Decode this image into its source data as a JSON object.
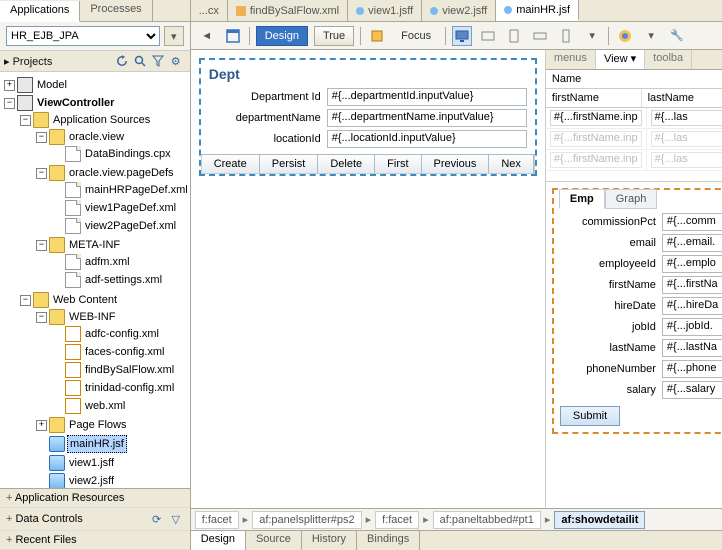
{
  "left": {
    "tabs": [
      "Applications",
      "Processes"
    ],
    "active_tab": 0,
    "dropdown": "HR_EJB_JPA",
    "section": "Projects",
    "tree": {
      "model": "Model",
      "vc": "ViewController",
      "app_src": "Application Sources",
      "ov": "oracle.view",
      "db": "DataBindings.cpx",
      "ovpd": "oracle.view.pageDefs",
      "pd1": "mainHRPageDef.xml",
      "pd2": "view1PageDef.xml",
      "pd3": "view2PageDef.xml",
      "meta": "META-INF",
      "adfm": "adfm.xml",
      "adfs": "adf-settings.xml",
      "wc": "Web Content",
      "webinf": "WEB-INF",
      "wi1": "adfc-config.xml",
      "wi2": "faces-config.xml",
      "wi3": "findBySalFlow.xml",
      "wi4": "trinidad-config.xml",
      "wi5": "web.xml",
      "pf": "Page Flows",
      "main": "mainHR.jsf",
      "v1": "view1.jsff",
      "v2": "view2.jsff"
    },
    "accordions": [
      "Application Resources",
      "Data Controls",
      "Recent Files"
    ]
  },
  "editor": {
    "tabs": [
      {
        "label": "...cx"
      },
      {
        "label": "findBySalFlow.xml"
      },
      {
        "label": "view1.jsff"
      },
      {
        "label": "view2.jsff"
      },
      {
        "label": "mainHR.jsf"
      }
    ],
    "active_tab": 4,
    "toolbar": {
      "design": "Design",
      "true": "True",
      "focus": "Focus"
    }
  },
  "dept": {
    "title": "Dept",
    "fields": [
      {
        "label": "Department Id",
        "value": "#{...departmentId.inputValue}"
      },
      {
        "label": "departmentName",
        "value": "#{...departmentName.inputValue}"
      },
      {
        "label": "locationId",
        "value": "#{...locationId.inputValue}"
      }
    ],
    "buttons": [
      "Create",
      "Persist",
      "Delete",
      "First",
      "Previous",
      "Nex"
    ]
  },
  "palette": {
    "tabs": [
      "menus",
      "View",
      "toolba"
    ],
    "active": 1,
    "table": {
      "header_full": "Name",
      "headers": [
        "firstName",
        "lastName"
      ],
      "rows": [
        [
          "#{...firstName.inp",
          "#{...las"
        ],
        [
          "#{...firstName.inp",
          "#{...las"
        ],
        [
          "#{...firstName.inp",
          "#{...las"
        ]
      ]
    }
  },
  "emp": {
    "tabs": [
      "Emp",
      "Graph"
    ],
    "active": 0,
    "fields": [
      {
        "label": "commissionPct",
        "value": "#{...comm"
      },
      {
        "label": "email",
        "value": "#{...email."
      },
      {
        "label": "employeeId",
        "value": "#{...emplo"
      },
      {
        "label": "firstName",
        "value": "#{...firstNa"
      },
      {
        "label": "hireDate",
        "value": "#{...hireDa"
      },
      {
        "label": "jobId",
        "value": "#{...jobId."
      },
      {
        "label": "lastName",
        "value": "#{...lastNa"
      },
      {
        "label": "phoneNumber",
        "value": "#{...phone"
      },
      {
        "label": "salary",
        "value": "#{...salary"
      }
    ],
    "submit": "Submit"
  },
  "breadcrumb": [
    "f:facet",
    "af:panelsplitter#ps2",
    "f:facet",
    "af:paneltabbed#pt1",
    "af:showdetailit"
  ],
  "bottom_tabs": [
    "Design",
    "Source",
    "History",
    "Bindings"
  ],
  "bottom_active": 0
}
